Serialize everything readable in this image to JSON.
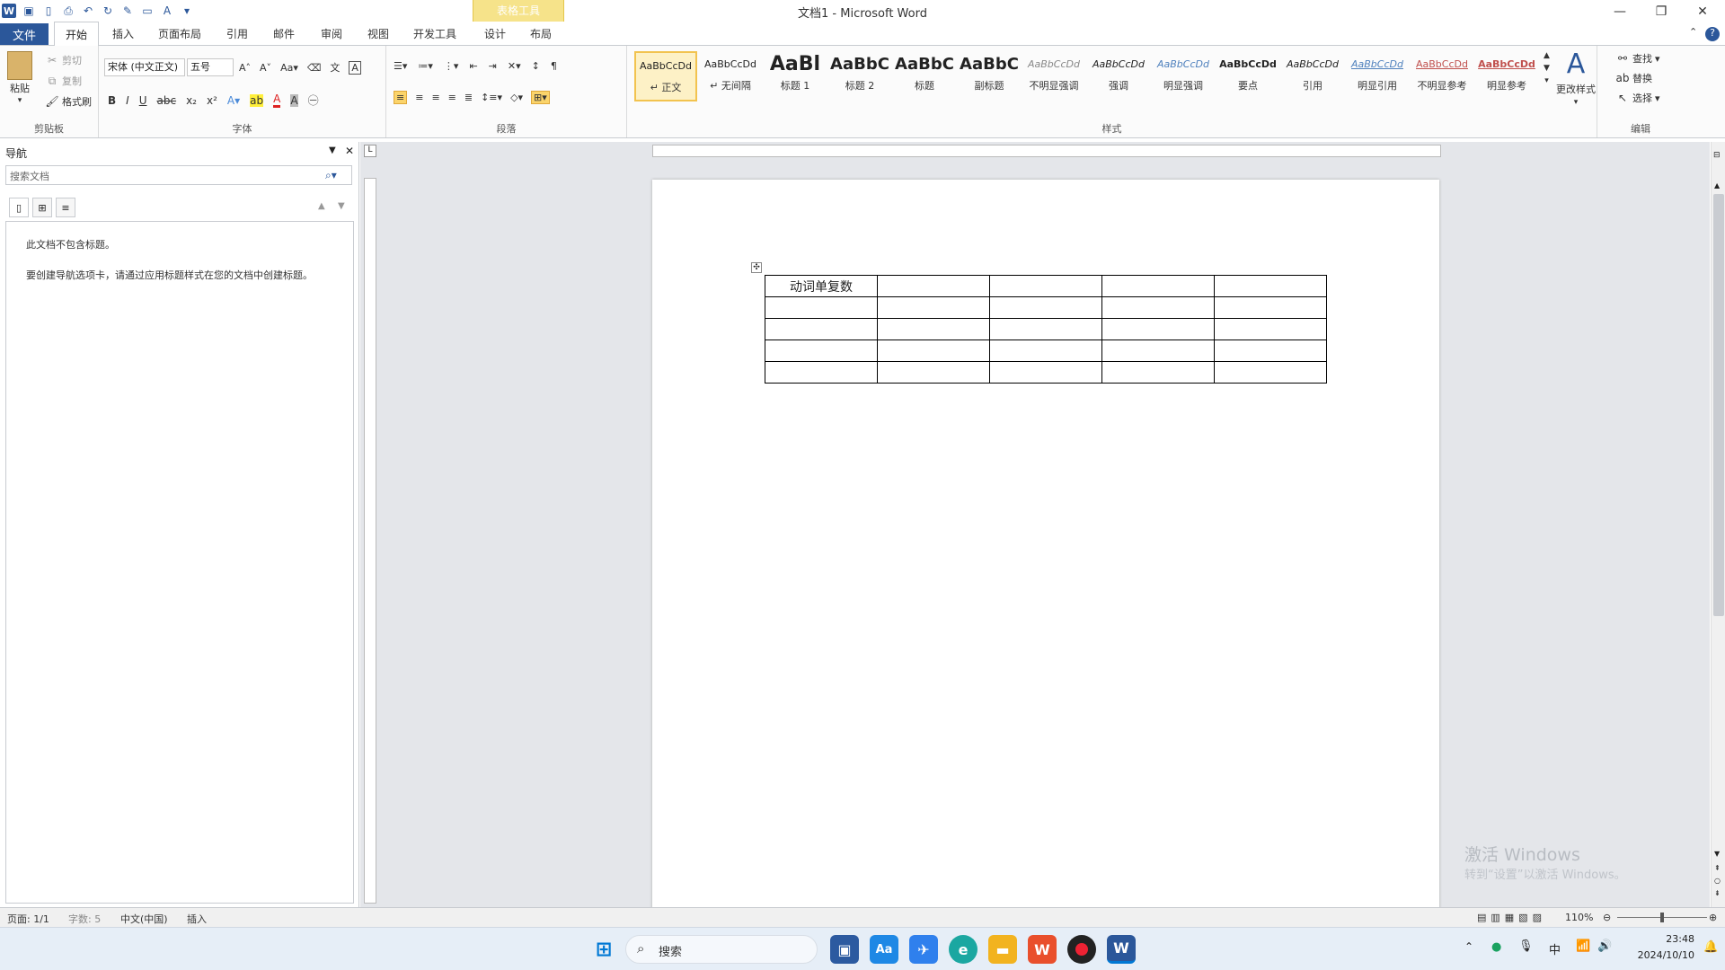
{
  "window": {
    "title": "文档1 - Microsoft Word",
    "context_group": "表格工具"
  },
  "tabs": {
    "file": "文件",
    "home": "开始",
    "insert": "插入",
    "page_layout": "页面布局",
    "references": "引用",
    "mailings": "邮件",
    "review": "审阅",
    "view": "视图",
    "developer": "开发工具",
    "design": "设计",
    "layout": "布局"
  },
  "clipboard": {
    "paste": "粘贴",
    "cut": "剪切",
    "copy": "复制",
    "format_painter": "格式刷",
    "label": "剪贴板"
  },
  "font": {
    "name": "宋体 (中文正文)",
    "size": "五号",
    "label": "字体"
  },
  "paragraph": {
    "label": "段落"
  },
  "styles": {
    "label": "样式",
    "items": [
      {
        "preview": "AaBbCcDd",
        "name": "↵ 正文"
      },
      {
        "preview": "AaBbCcDd",
        "name": "↵ 无间隔"
      },
      {
        "preview": "AaBl",
        "name": "标题 1"
      },
      {
        "preview": "AaBbC",
        "name": "标题 2"
      },
      {
        "preview": "AaBbC",
        "name": "标题"
      },
      {
        "preview": "AaBbC",
        "name": "副标题"
      },
      {
        "preview": "AaBbCcDd",
        "name": "不明显强调"
      },
      {
        "preview": "AaBbCcDd",
        "name": "强调"
      },
      {
        "preview": "AaBbCcDd",
        "name": "明显强调"
      },
      {
        "preview": "AaBbCcDd",
        "name": "要点"
      },
      {
        "preview": "AaBbCcDd",
        "name": "引用"
      },
      {
        "preview": "AaBbCcDd",
        "name": "明显引用"
      },
      {
        "preview": "AaBbCcDd",
        "name": "不明显参考"
      },
      {
        "preview": "AaBbCcDd",
        "name": "明显参考"
      }
    ],
    "change": "更改样式"
  },
  "editing": {
    "find": "查找",
    "replace": "替换",
    "select": "选择",
    "label": "编辑"
  },
  "nav": {
    "title": "导航",
    "search_placeholder": "搜索文档",
    "msg1": "此文档不包含标题。",
    "msg2": "要创建导航选项卡，请通过应用标题样式在您的文档中创建标题。"
  },
  "table": {
    "cell_1_1": "动词单复数"
  },
  "status": {
    "page": "页面: 1/1",
    "words": "字数: 5",
    "lang": "中文(中国)",
    "mode": "插入",
    "zoom": "110%"
  },
  "watermark": {
    "line1": "激活 Windows",
    "line2": "转到“设置”以激活 Windows。"
  },
  "taskbar": {
    "search": "搜索",
    "time": "23:48",
    "date": "2024/10/10",
    "ime": "中"
  }
}
